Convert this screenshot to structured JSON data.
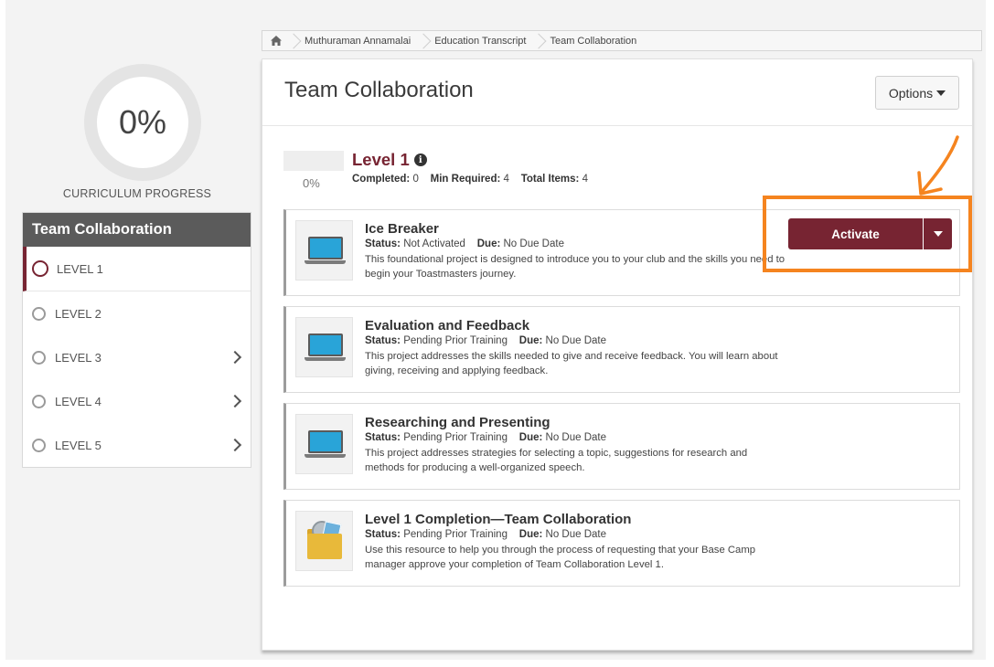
{
  "progress": {
    "percent_label": "0%",
    "label": "CURRICULUM PROGRESS"
  },
  "sidebar": {
    "title": "Team Collaboration",
    "items": [
      {
        "label": "LEVEL 1",
        "active": true,
        "has_arrow": false
      },
      {
        "label": "LEVEL 2",
        "active": false,
        "has_arrow": false
      },
      {
        "label": "LEVEL 3",
        "active": false,
        "has_arrow": true
      },
      {
        "label": "LEVEL 4",
        "active": false,
        "has_arrow": true
      },
      {
        "label": "LEVEL 5",
        "active": false,
        "has_arrow": true
      }
    ]
  },
  "breadcrumb": {
    "home_icon": "home-icon",
    "items": [
      "Muthuraman Annamalai",
      "Education Transcript",
      "Team Collaboration"
    ]
  },
  "main": {
    "title": "Team Collaboration",
    "options_label": "Options",
    "level": {
      "title": "Level 1",
      "percent": "0%",
      "completed_label": "Completed:",
      "completed_value": "0",
      "min_required_label": "Min Required:",
      "min_required_value": "4",
      "total_items_label": "Total Items:",
      "total_items_value": "4"
    },
    "items": [
      {
        "icon": "laptop-icon",
        "title": "Ice Breaker",
        "status_label": "Status:",
        "status": "Not Activated",
        "due_label": "Due:",
        "due": "No Due Date",
        "description": "This foundational project is designed to introduce you to your club and the skills you need to begin your Toastmasters journey.",
        "action_label": "Activate"
      },
      {
        "icon": "laptop-icon",
        "title": "Evaluation and Feedback",
        "status_label": "Status:",
        "status": "Pending Prior Training",
        "due_label": "Due:",
        "due": "No Due Date",
        "description": "This project addresses the skills needed to give and receive feedback. You will learn about giving, receiving and applying feedback."
      },
      {
        "icon": "laptop-icon",
        "title": "Researching and Presenting",
        "status_label": "Status:",
        "status": "Pending Prior Training",
        "due_label": "Due:",
        "due": "No Due Date",
        "description": "This project addresses strategies for selecting a topic, suggestions for research and methods for producing a well-organized speech."
      },
      {
        "icon": "folder-icon",
        "title": "Level 1 Completion—Team Collaboration",
        "status_label": "Status:",
        "status": "Pending Prior Training",
        "due_label": "Due:",
        "due": "No Due Date",
        "description": "Use this resource to help you through the process of requesting that your Base Camp manager approve your completion of Team Collaboration Level 1."
      }
    ]
  },
  "colors": {
    "brand": "#772432",
    "annotation": "#f5841f",
    "laptop_screen": "#29a4d8"
  }
}
